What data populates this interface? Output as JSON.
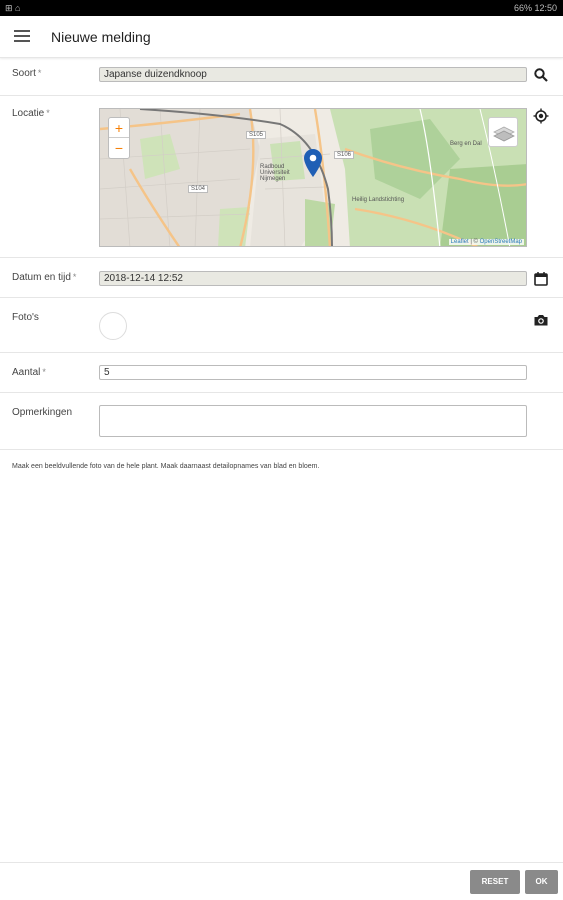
{
  "statusbar": {
    "left": "⊞ ⌂",
    "right": "66% 12:50"
  },
  "app": {
    "title": "Nieuwe melding"
  },
  "form": {
    "soort": {
      "label": "Soort",
      "required_mark": "*",
      "value": "Japanse duizendknoop"
    },
    "locatie": {
      "label": "Locatie",
      "required_mark": "*"
    },
    "datum": {
      "label": "Datum en tijd",
      "required_mark": "*",
      "value": "2018-12-14 12:52"
    },
    "fotos": {
      "label": "Foto's"
    },
    "aantal": {
      "label": "Aantal",
      "required_mark": "*",
      "value": "5"
    },
    "opmerkingen": {
      "label": "Opmerkingen",
      "value": ""
    }
  },
  "map": {
    "zoom_in": "+",
    "zoom_out": "−",
    "attribution_leaflet": "Leaflet",
    "attribution_sep": " | © ",
    "attribution_osm": "OpenStreetMap",
    "labels": {
      "berg": "Berg en Dal",
      "heilig": "Heilig Landstichting",
      "raadhuis": "Radboud Universiteit Nijmegen",
      "s105": "S105",
      "s106": "S106",
      "s104": "S104"
    },
    "colors": {
      "park": "#c8dfb2",
      "forest": "#aecf96",
      "urban": "#e0dcd6",
      "road": "#f6c98a",
      "rail": "#777777",
      "marker": "#1f5fb5"
    }
  },
  "hint": "Maak een beeldvullende foto van de hele plant. Maak daarnaast detailopnames van blad en bloem.",
  "buttons": {
    "reset": "RESET",
    "ok": "OK"
  }
}
